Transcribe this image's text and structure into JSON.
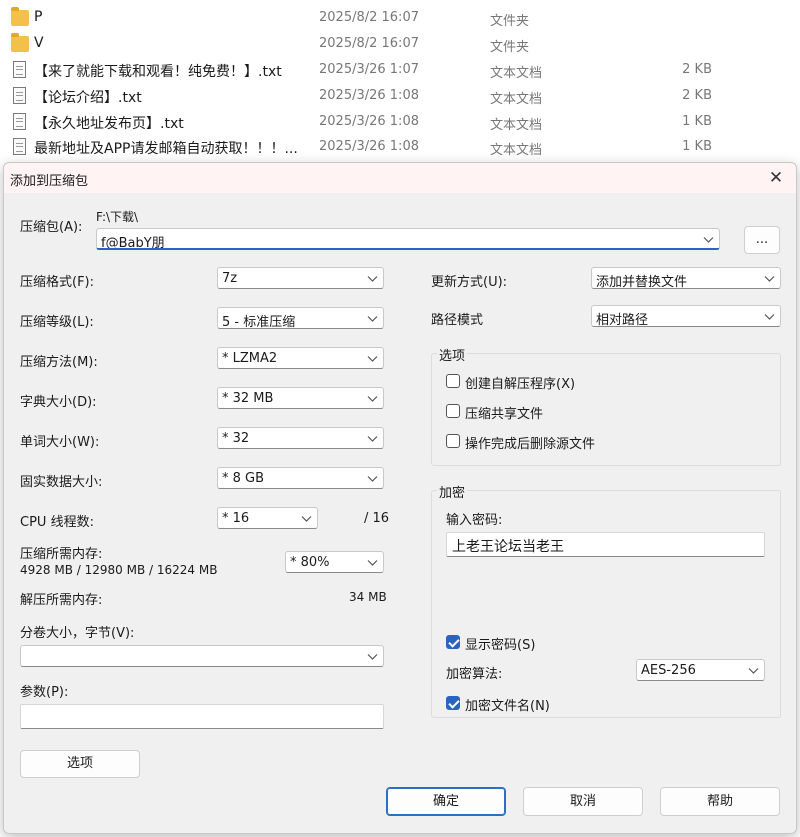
{
  "files": [
    {
      "name": "P",
      "date": "2025/8/2 16:07",
      "type": "文件夹",
      "size": "",
      "icon": "folder-icon"
    },
    {
      "name": "V",
      "date": "2025/8/2 16:07",
      "type": "文件夹",
      "size": "",
      "icon": "folder-icon"
    },
    {
      "name": "【来了就能下载和观看！纯免费！】.txt",
      "date": "2025/3/26 1:07",
      "type": "文本文档",
      "size": "2 KB",
      "icon": "text-file-icon"
    },
    {
      "name": "【论坛介绍】.txt",
      "date": "2025/3/26 1:08",
      "type": "文本文档",
      "size": "2 KB",
      "icon": "text-file-icon"
    },
    {
      "name": "【永久地址发布页】.txt",
      "date": "2025/3/26 1:08",
      "type": "文本文档",
      "size": "1 KB",
      "icon": "text-file-icon"
    },
    {
      "name": "最新地址及APP请发邮箱自动获取！！！...",
      "date": "2025/3/26 1:08",
      "type": "文本文档",
      "size": "1 KB",
      "icon": "text-file-icon"
    }
  ],
  "dialog": {
    "title": "添加到压缩包",
    "close": "✕",
    "archive": {
      "label": "压缩包(A):",
      "path": "F:\\下载\\",
      "value": "f@BabY朋",
      "browse": "..."
    },
    "format": {
      "label": "压缩格式(F):",
      "value": "7z"
    },
    "level": {
      "label": "压缩等级(L):",
      "value": "5 - 标准压缩"
    },
    "method": {
      "label": "压缩方法(M):",
      "value": "* LZMA2"
    },
    "dict": {
      "label": "字典大小(D):",
      "value": "* 32 MB"
    },
    "word": {
      "label": "单词大小(W):",
      "value": "* 32"
    },
    "solid": {
      "label": "固实数据大小:",
      "value": "* 8 GB"
    },
    "cpu": {
      "label": "CPU 线程数:",
      "value": "* 16",
      "max": "/ 16"
    },
    "mem": {
      "label": "压缩所需内存:",
      "detail": "4928 MB / 12980 MB / 16224 MB",
      "value": "* 80%"
    },
    "decomp": {
      "label": "解压所需内存:",
      "value": "34 MB"
    },
    "volume": {
      "label": "分卷大小，字节(V):",
      "value": ""
    },
    "params": {
      "label": "参数(P):",
      "value": ""
    },
    "options_button": "选项",
    "update": {
      "label": "更新方式(U):",
      "value": "添加并替换文件"
    },
    "path_mode": {
      "label": "路径模式",
      "value": "相对路径"
    },
    "options_group": {
      "title": "选项",
      "items": [
        {
          "label": "创建自解压程序(X)",
          "checked": false
        },
        {
          "label": "压缩共享文件",
          "checked": false
        },
        {
          "label": "操作完成后删除源文件",
          "checked": false
        }
      ]
    },
    "encryption": {
      "title": "加密",
      "password_label": "输入密码:",
      "password": "上老王论坛当老王",
      "show_password": {
        "label": "显示密码(S)",
        "checked": true
      },
      "algo_label": "加密算法:",
      "algo": "AES-256",
      "encrypt_names": {
        "label": "加密文件名(N)",
        "checked": true
      }
    },
    "ok": "确定",
    "cancel": "取消",
    "help": "帮助"
  }
}
